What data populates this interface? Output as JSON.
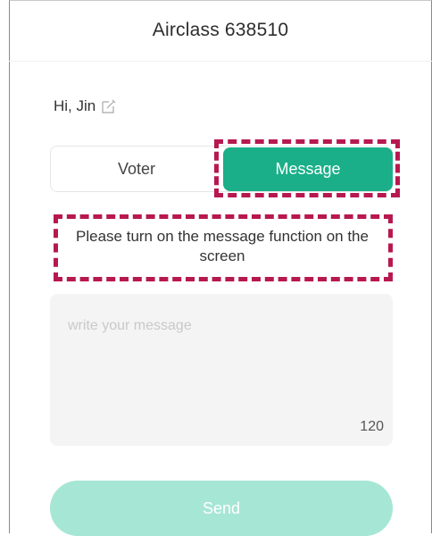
{
  "header": {
    "title": "Airclass 638510"
  },
  "greeting": {
    "text": "Hi, Jin",
    "edit_icon": "edit-icon"
  },
  "tabs": [
    {
      "label": "Voter",
      "selected": false
    },
    {
      "label": "Message",
      "selected": true
    }
  ],
  "notice": {
    "text": "Please turn on the message function on the screen"
  },
  "message": {
    "placeholder": "write your message",
    "value": "",
    "char_count": "120"
  },
  "send": {
    "label": "Send"
  },
  "colors": {
    "accent": "#1aaf88",
    "accent_disabled": "#a6e6d4",
    "highlight": "#b71850",
    "input_bg": "#f4f4f4"
  }
}
